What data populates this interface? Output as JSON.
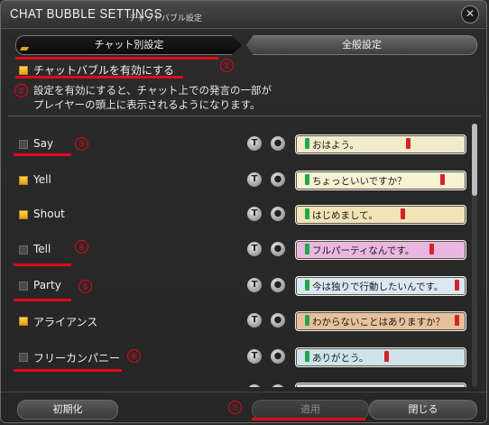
{
  "window": {
    "title": "CHAT BUBBLE SETTINGS",
    "subtitle": "チャットバブル設定",
    "close_icon": "close-icon"
  },
  "tabs": [
    {
      "label": "チャット別設定",
      "active": true
    },
    {
      "label": "全般設定",
      "active": false
    }
  ],
  "enable": {
    "label": "チャットバブルを有効にする",
    "checked": true,
    "description_line1": "設定を有効にすると、チャット上での発言の一部が",
    "description_line2": "プレイヤーの頭上に表示されるようになります。"
  },
  "rows": [
    {
      "label": "Say",
      "checked": false,
      "preview": "おはよう。",
      "bubble_color": "#f3eccb"
    },
    {
      "label": "Yell",
      "checked": true,
      "preview": "ちょっといいですか？",
      "bubble_color": "#f6f2d2"
    },
    {
      "label": "Shout",
      "checked": true,
      "preview": "はじめまして。",
      "bubble_color": "#f4e3b6"
    },
    {
      "label": "Tell",
      "checked": false,
      "preview": "フルパーティなんです。",
      "bubble_color": "#e9b7df"
    },
    {
      "label": "Party",
      "checked": false,
      "preview": "今は独りで行動したいんです。",
      "bubble_color": "#dbe8f3"
    },
    {
      "label": "アライアンス",
      "checked": true,
      "preview": "わからないことはありますか？",
      "bubble_color": "#e8c19b"
    },
    {
      "label": "フリーカンパニー",
      "checked": false,
      "preview": "ありがとう。",
      "bubble_color": "#cfe4ea"
    },
    {
      "label": "",
      "checked": false,
      "preview": "",
      "bubble_color": "#d9e0ea"
    }
  ],
  "row_buttons": {
    "t_label": "T",
    "bubble_icon": "speech-bubble-icon"
  },
  "footer": {
    "reset_label": "初期化",
    "apply_label": "適用",
    "close_label": "閉じる"
  },
  "annotations": [
    "①",
    "②",
    "③",
    "④",
    "⑤",
    "⑥",
    "⑦"
  ],
  "colors": {
    "annotation": "#e10a1a",
    "checkbox_on": "#e0a117"
  }
}
